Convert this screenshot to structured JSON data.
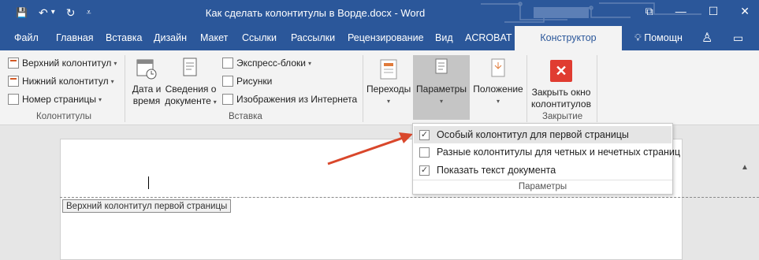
{
  "window": {
    "title": "Как сделать колонтитулы в Ворде.docx - Word",
    "controls": {
      "restore": "⧉",
      "minimize": "—",
      "maximize": "☐",
      "close": "✕"
    }
  },
  "qat": {
    "save": "💾",
    "undo": "↶",
    "undo_caret": "▾",
    "redo": "↻",
    "customize": "⩡"
  },
  "tabs": [
    {
      "label": "Файл"
    },
    {
      "label": "Главная"
    },
    {
      "label": "Вставка"
    },
    {
      "label": "Дизайн"
    },
    {
      "label": "Макет"
    },
    {
      "label": "Ссылки"
    },
    {
      "label": "Рассылки"
    },
    {
      "label": "Рецензирование"
    },
    {
      "label": "Вид"
    },
    {
      "label": "ACROBAT"
    },
    {
      "label": "Конструктор"
    }
  ],
  "tellme": {
    "icon": "lightbulb-icon",
    "label": "Помощн"
  },
  "ribbon": {
    "headers_footers": {
      "header": "Верхний колонтитул",
      "footer": "Нижний колонтитул",
      "page_number": "Номер страницы",
      "group_label": "Колонтитулы"
    },
    "insert": {
      "date_time_line1": "Дата и",
      "date_time_line2": "время",
      "doc_info_line1": "Сведения о",
      "doc_info_line2": "документе",
      "quick_parts": "Экспресс-блоки",
      "pictures": "Рисунки",
      "online_pictures": "Изображения из Интернета",
      "group_label": "Вставка"
    },
    "navigation": {
      "label": "Переходы"
    },
    "options": {
      "label": "Параметры"
    },
    "position": {
      "label": "Положение"
    },
    "close": {
      "line1": "Закрыть окно",
      "line2": "колонтитулов",
      "group_label": "Закрытие"
    }
  },
  "dropdown": {
    "options": [
      {
        "label": "Особый колонтитул для первой страницы",
        "checked": true
      },
      {
        "label": "Разные колонтитулы для четных и нечетных страниц",
        "checked": false
      },
      {
        "label": "Показать текст документа",
        "checked": true
      }
    ],
    "footer": "Параметры"
  },
  "document": {
    "header_tag": "Верхний колонтитул первой страницы"
  },
  "colors": {
    "accent": "#2b579a",
    "arrow": "#d9472b",
    "close": "#e03c31"
  }
}
